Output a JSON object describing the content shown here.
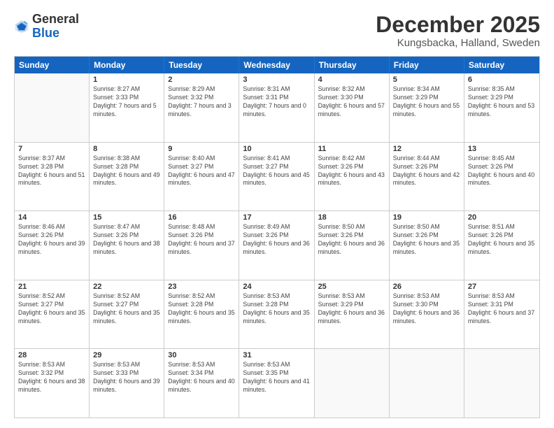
{
  "header": {
    "logo": {
      "general": "General",
      "blue": "Blue"
    },
    "title": "December 2025",
    "location": "Kungsbacka, Halland, Sweden"
  },
  "weekdays": [
    "Sunday",
    "Monday",
    "Tuesday",
    "Wednesday",
    "Thursday",
    "Friday",
    "Saturday"
  ],
  "weeks": [
    [
      {
        "day": "",
        "sunrise": "",
        "sunset": "",
        "daylight": ""
      },
      {
        "day": "1",
        "sunrise": "Sunrise: 8:27 AM",
        "sunset": "Sunset: 3:33 PM",
        "daylight": "Daylight: 7 hours and 5 minutes."
      },
      {
        "day": "2",
        "sunrise": "Sunrise: 8:29 AM",
        "sunset": "Sunset: 3:32 PM",
        "daylight": "Daylight: 7 hours and 3 minutes."
      },
      {
        "day": "3",
        "sunrise": "Sunrise: 8:31 AM",
        "sunset": "Sunset: 3:31 PM",
        "daylight": "Daylight: 7 hours and 0 minutes."
      },
      {
        "day": "4",
        "sunrise": "Sunrise: 8:32 AM",
        "sunset": "Sunset: 3:30 PM",
        "daylight": "Daylight: 6 hours and 57 minutes."
      },
      {
        "day": "5",
        "sunrise": "Sunrise: 8:34 AM",
        "sunset": "Sunset: 3:29 PM",
        "daylight": "Daylight: 6 hours and 55 minutes."
      },
      {
        "day": "6",
        "sunrise": "Sunrise: 8:35 AM",
        "sunset": "Sunset: 3:29 PM",
        "daylight": "Daylight: 6 hours and 53 minutes."
      }
    ],
    [
      {
        "day": "7",
        "sunrise": "Sunrise: 8:37 AM",
        "sunset": "Sunset: 3:28 PM",
        "daylight": "Daylight: 6 hours and 51 minutes."
      },
      {
        "day": "8",
        "sunrise": "Sunrise: 8:38 AM",
        "sunset": "Sunset: 3:28 PM",
        "daylight": "Daylight: 6 hours and 49 minutes."
      },
      {
        "day": "9",
        "sunrise": "Sunrise: 8:40 AM",
        "sunset": "Sunset: 3:27 PM",
        "daylight": "Daylight: 6 hours and 47 minutes."
      },
      {
        "day": "10",
        "sunrise": "Sunrise: 8:41 AM",
        "sunset": "Sunset: 3:27 PM",
        "daylight": "Daylight: 6 hours and 45 minutes."
      },
      {
        "day": "11",
        "sunrise": "Sunrise: 8:42 AM",
        "sunset": "Sunset: 3:26 PM",
        "daylight": "Daylight: 6 hours and 43 minutes."
      },
      {
        "day": "12",
        "sunrise": "Sunrise: 8:44 AM",
        "sunset": "Sunset: 3:26 PM",
        "daylight": "Daylight: 6 hours and 42 minutes."
      },
      {
        "day": "13",
        "sunrise": "Sunrise: 8:45 AM",
        "sunset": "Sunset: 3:26 PM",
        "daylight": "Daylight: 6 hours and 40 minutes."
      }
    ],
    [
      {
        "day": "14",
        "sunrise": "Sunrise: 8:46 AM",
        "sunset": "Sunset: 3:26 PM",
        "daylight": "Daylight: 6 hours and 39 minutes."
      },
      {
        "day": "15",
        "sunrise": "Sunrise: 8:47 AM",
        "sunset": "Sunset: 3:26 PM",
        "daylight": "Daylight: 6 hours and 38 minutes."
      },
      {
        "day": "16",
        "sunrise": "Sunrise: 8:48 AM",
        "sunset": "Sunset: 3:26 PM",
        "daylight": "Daylight: 6 hours and 37 minutes."
      },
      {
        "day": "17",
        "sunrise": "Sunrise: 8:49 AM",
        "sunset": "Sunset: 3:26 PM",
        "daylight": "Daylight: 6 hours and 36 minutes."
      },
      {
        "day": "18",
        "sunrise": "Sunrise: 8:50 AM",
        "sunset": "Sunset: 3:26 PM",
        "daylight": "Daylight: 6 hours and 36 minutes."
      },
      {
        "day": "19",
        "sunrise": "Sunrise: 8:50 AM",
        "sunset": "Sunset: 3:26 PM",
        "daylight": "Daylight: 6 hours and 35 minutes."
      },
      {
        "day": "20",
        "sunrise": "Sunrise: 8:51 AM",
        "sunset": "Sunset: 3:26 PM",
        "daylight": "Daylight: 6 hours and 35 minutes."
      }
    ],
    [
      {
        "day": "21",
        "sunrise": "Sunrise: 8:52 AM",
        "sunset": "Sunset: 3:27 PM",
        "daylight": "Daylight: 6 hours and 35 minutes."
      },
      {
        "day": "22",
        "sunrise": "Sunrise: 8:52 AM",
        "sunset": "Sunset: 3:27 PM",
        "daylight": "Daylight: 6 hours and 35 minutes."
      },
      {
        "day": "23",
        "sunrise": "Sunrise: 8:52 AM",
        "sunset": "Sunset: 3:28 PM",
        "daylight": "Daylight: 6 hours and 35 minutes."
      },
      {
        "day": "24",
        "sunrise": "Sunrise: 8:53 AM",
        "sunset": "Sunset: 3:28 PM",
        "daylight": "Daylight: 6 hours and 35 minutes."
      },
      {
        "day": "25",
        "sunrise": "Sunrise: 8:53 AM",
        "sunset": "Sunset: 3:29 PM",
        "daylight": "Daylight: 6 hours and 36 minutes."
      },
      {
        "day": "26",
        "sunrise": "Sunrise: 8:53 AM",
        "sunset": "Sunset: 3:30 PM",
        "daylight": "Daylight: 6 hours and 36 minutes."
      },
      {
        "day": "27",
        "sunrise": "Sunrise: 8:53 AM",
        "sunset": "Sunset: 3:31 PM",
        "daylight": "Daylight: 6 hours and 37 minutes."
      }
    ],
    [
      {
        "day": "28",
        "sunrise": "Sunrise: 8:53 AM",
        "sunset": "Sunset: 3:32 PM",
        "daylight": "Daylight: 6 hours and 38 minutes."
      },
      {
        "day": "29",
        "sunrise": "Sunrise: 8:53 AM",
        "sunset": "Sunset: 3:33 PM",
        "daylight": "Daylight: 6 hours and 39 minutes."
      },
      {
        "day": "30",
        "sunrise": "Sunrise: 8:53 AM",
        "sunset": "Sunset: 3:34 PM",
        "daylight": "Daylight: 6 hours and 40 minutes."
      },
      {
        "day": "31",
        "sunrise": "Sunrise: 8:53 AM",
        "sunset": "Sunset: 3:35 PM",
        "daylight": "Daylight: 6 hours and 41 minutes."
      },
      {
        "day": "",
        "sunrise": "",
        "sunset": "",
        "daylight": ""
      },
      {
        "day": "",
        "sunrise": "",
        "sunset": "",
        "daylight": ""
      },
      {
        "day": "",
        "sunrise": "",
        "sunset": "",
        "daylight": ""
      }
    ]
  ]
}
